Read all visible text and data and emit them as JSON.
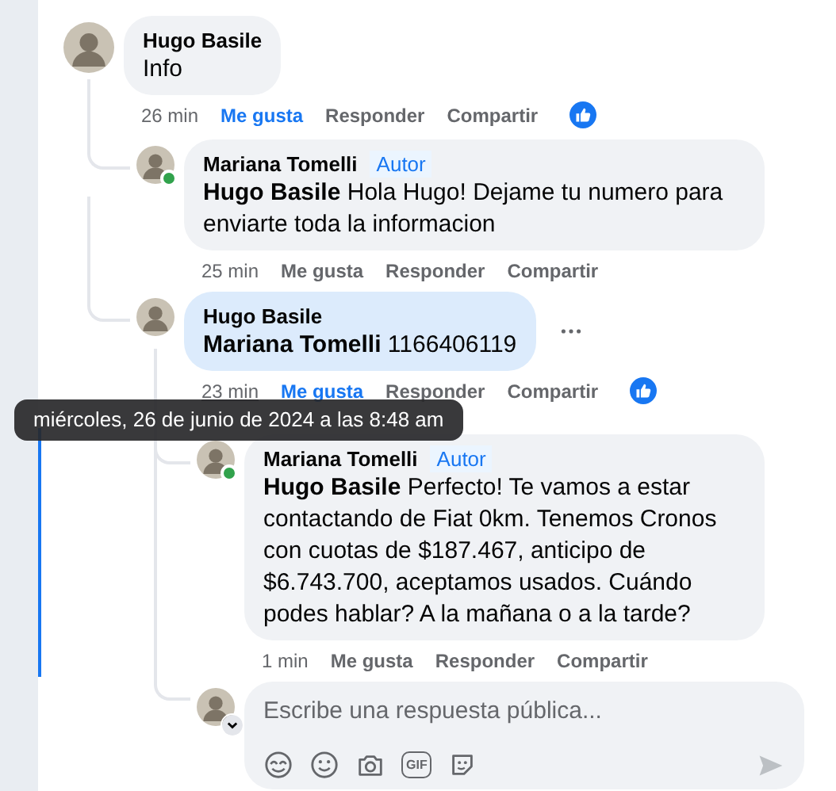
{
  "comments": [
    {
      "kind": "comment",
      "author": "Hugo Basile",
      "text": "Info",
      "time": "26 min",
      "like_label": "Me gusta",
      "reply_label": "Responder",
      "share_label": "Compartir",
      "liked": true,
      "has_reactions": true,
      "children": [
        {
          "kind": "comment",
          "author": "Mariana Tomelli",
          "badge": "Autor",
          "online": true,
          "text": "**Hugo Basile** Hola Hugo! Dejame tu numero para enviarte toda la informacion",
          "time": "25 min",
          "like_label": "Me gusta",
          "reply_label": "Responder",
          "share_label": "Compartir",
          "liked": false,
          "has_reactions": false
        },
        {
          "kind": "comment",
          "author": "Hugo Basile",
          "text": "**Mariana Tomelli** 1166406119",
          "time": "23 min",
          "time_hovered": true,
          "highlighted": true,
          "more_menu": true,
          "like_label": "Me gusta",
          "reply_label": "Responder",
          "share_label": "Compartir",
          "liked": true,
          "has_reactions": true,
          "children": [
            {
              "kind": "comment",
              "author": "Mariana Tomelli",
              "badge": "Autor",
              "online": true,
              "focused": true,
              "text": "**Hugo Basile** Perfecto! Te vamos a estar contactando de Fiat 0km. Tenemos Cronos con cuotas de $187.467, anticipo de $6.743.700, aceptamos usados. Cuándo podes hablar? A la mañana o a la tarde?",
              "time": "1 min",
              "like_label": "Me gusta",
              "reply_label": "Responder",
              "share_label": "Compartir",
              "liked": false,
              "has_reactions": false
            },
            {
              "kind": "composer",
              "placeholder": "Escribe una respuesta pública...",
              "gif_label": "GIF"
            }
          ]
        }
      ]
    }
  ],
  "tooltip": {
    "text": "miércoles, 26 de junio de 2024 a las 8:48 am"
  }
}
